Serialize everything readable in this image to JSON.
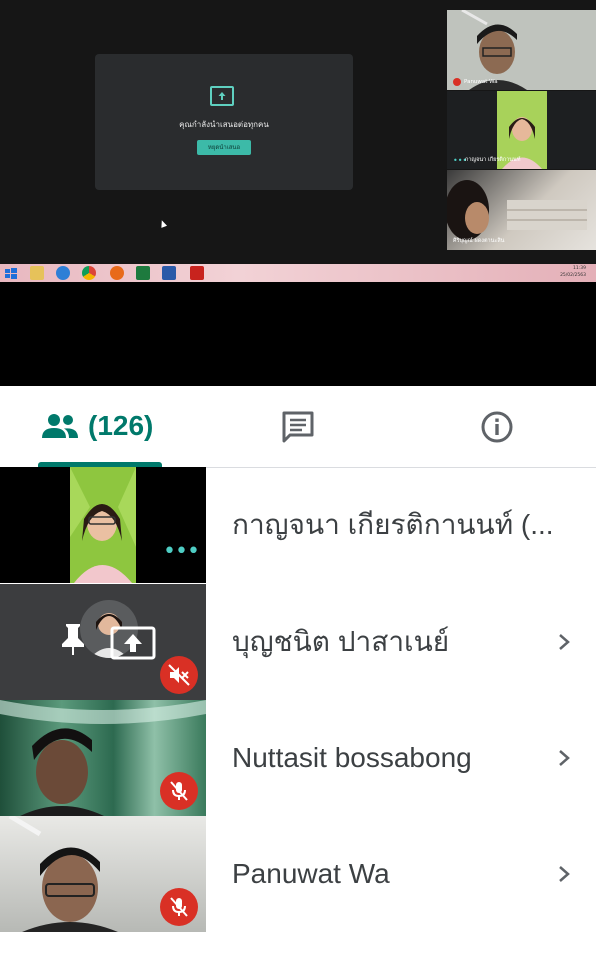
{
  "screen_share": {
    "presentation_card": {
      "message": "คุณกำลังนำเสนอต่อทุกคน",
      "stop_button": "หยุดนำเสนอ"
    },
    "video_tiles": [
      {
        "label": "Panuwat Wa"
      },
      {
        "label": "กาญจนา เกียรติกานนท์"
      },
      {
        "label": "ศิริบุญณ์ ผดงตานะสิน"
      }
    ],
    "taskbar": {
      "time": "11:39",
      "date": "25/02/2563",
      "apps": [
        "start",
        "explorer",
        "ie",
        "chrome",
        "firefox",
        "excel",
        "word",
        "acrobat"
      ]
    }
  },
  "tabs": {
    "people_count": "(126)",
    "icons": [
      "people-icon",
      "chat-icon",
      "info-icon"
    ],
    "accent": "#00796b"
  },
  "participants": [
    {
      "name": "กาญจนา เกียรติกานนท์ (..."
    },
    {
      "name": "บุญชนิต ปาสาเนย์"
    },
    {
      "name": "Nuttasit bossabong"
    },
    {
      "name": "Panuwat Wa"
    }
  ],
  "colors": {
    "mute_badge": "#d93025",
    "more_dots": "#4ecdc4"
  }
}
